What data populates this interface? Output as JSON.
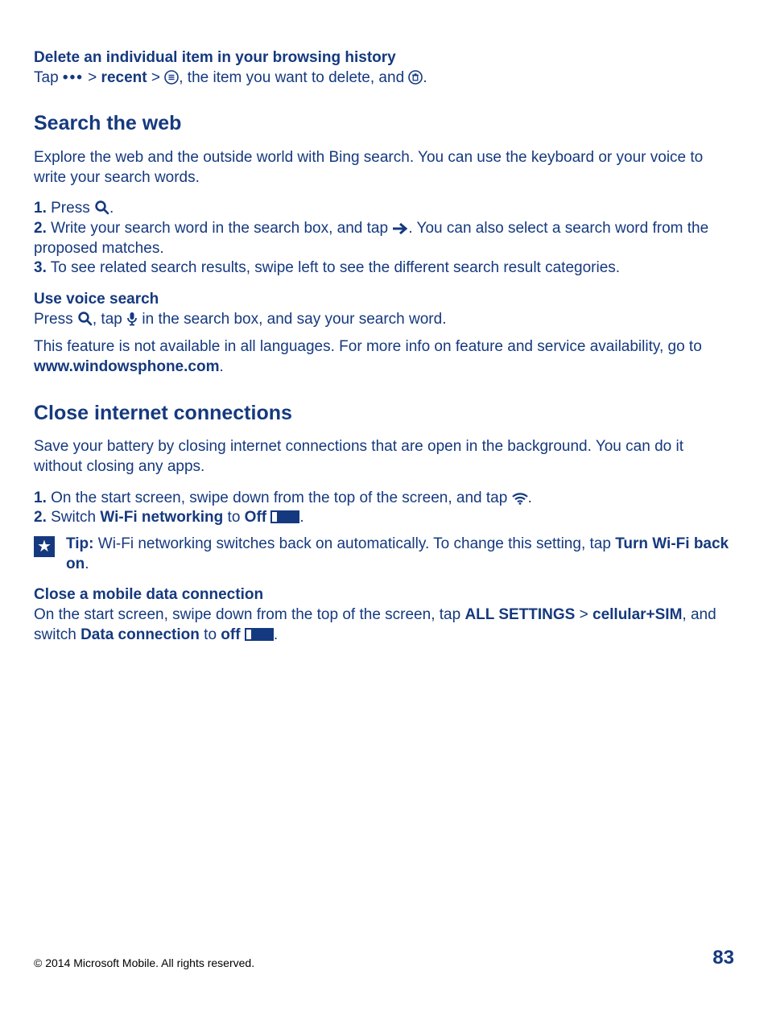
{
  "s1": {
    "heading": "Delete an individual item in your browsing history",
    "line_a": "Tap ",
    "line_b": " > ",
    "recent": "recent",
    "line_c": " > ",
    "line_d": ", the item you want to delete, and ",
    "line_e": "."
  },
  "s2": {
    "heading": "Search the web",
    "intro": "Explore the web and the outside world with Bing search. You can use the keyboard or your voice to write your search words.",
    "step1_n": "1.",
    "step1_a": " Press ",
    "step1_b": ".",
    "step2_n": "2.",
    "step2_a": " Write your search word in the search box, and tap ",
    "step2_b": ". You can also select a search word from the proposed matches.",
    "step3_n": "3.",
    "step3_a": " To see related search results, swipe left to see the different search result categories.",
    "voice_heading": "Use voice search",
    "voice_a": "Press ",
    "voice_b": ", tap ",
    "voice_c": " in the search box, and say your search word.",
    "note_a": "This feature is not available in all languages. For more info on feature and service availability, go to ",
    "note_link": "www.windowsphone.com",
    "note_b": "."
  },
  "s3": {
    "heading": "Close internet connections",
    "intro": "Save your battery by closing internet connections that are open in the background. You can do it without closing any apps.",
    "step1_n": "1.",
    "step1_a": " On the start screen, swipe down from the top of the screen, and tap ",
    "step1_b": ".",
    "step2_n": "2.",
    "step2_a": " Switch ",
    "step2_wifi": "Wi-Fi networking",
    "step2_b": " to ",
    "step2_off": "Off",
    "step2_c": " ",
    "step2_d": ".",
    "tip_label": "Tip: ",
    "tip_a": "Wi-Fi networking switches back on automatically. To change this setting, tap ",
    "tip_turn": "Turn Wi-Fi back on",
    "tip_b": ".",
    "mobile_heading": "Close a mobile data connection",
    "mobile_a": "On the start screen, swipe down from the top of the screen, tap ",
    "mobile_all": "ALL SETTINGS",
    "mobile_b": " > ",
    "mobile_cell": "cellular+SIM",
    "mobile_c": ", and switch ",
    "mobile_data": "Data connection",
    "mobile_d": " to ",
    "mobile_off": "off",
    "mobile_e": " ",
    "mobile_f": "."
  },
  "footer": {
    "copyright": "© 2014 Microsoft Mobile. All rights reserved.",
    "page": "83"
  }
}
